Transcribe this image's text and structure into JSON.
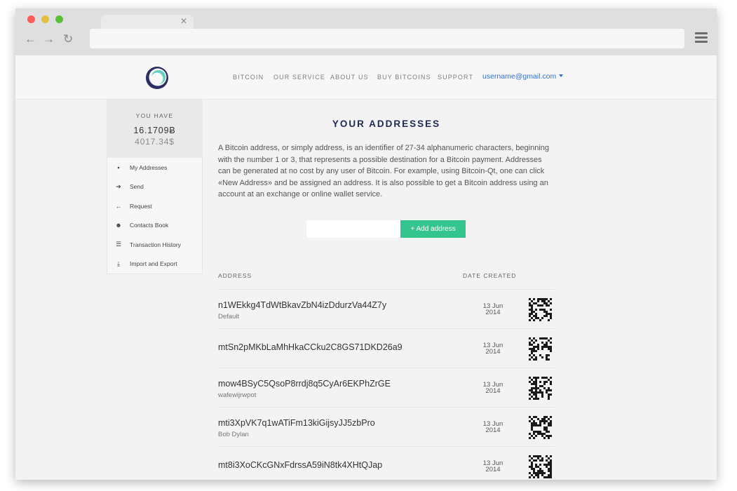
{
  "header": {
    "nav": [
      "BITCOIN",
      "OUR SERVICE",
      "ABOUT US",
      "BUY BITCOINS",
      "SUPPORT"
    ],
    "user": "username@gmail.com"
  },
  "sidebar": {
    "balance_label": "YOU HAVE",
    "balance_btc": "16.1709Ƀ",
    "balance_usd": "4017.34$",
    "items": [
      {
        "label": "My Addresses",
        "icon": "briefcase-icon"
      },
      {
        "label": "Send",
        "icon": "arrow-right-icon"
      },
      {
        "label": "Request",
        "icon": "arrow-left-icon"
      },
      {
        "label": "Contacts Book",
        "icon": "users-icon"
      },
      {
        "label": "Transaction History",
        "icon": "list-icon"
      },
      {
        "label": "Import and Export",
        "icon": "download-icon"
      }
    ]
  },
  "main": {
    "title": "YOUR ADDRESSES",
    "intro": "A Bitcoin address, or simply address, is an identifier of 27-34 alphanumeric characters, beginning with the number 1 or 3, that represents a possible destination for a Bitcoin payment. Addresses can be generated at no cost by any user of Bitcoin. For example, using Bitcoin-Qt, one can click «New Address» and be assigned an address. It is also possible to get a Bitcoin address using an account at an exchange or online wallet service.",
    "add_input_placeholder": "",
    "add_button": "+ Add address",
    "table": {
      "headers": {
        "address": "ADDRESS",
        "date_created": "DATE CREATED"
      },
      "rows": [
        {
          "address": "n1WEkkg4TdWtBkavZbN4izDdurzVa44Z7y",
          "label": "Default",
          "date_day": "13 Jun",
          "date_year": "2014"
        },
        {
          "address": "mtSn2pMKbLaMhHkaCCku2C8GS71DKD26a9",
          "label": "",
          "date_day": "13 Jun",
          "date_year": "2014"
        },
        {
          "address": "mow4BSyC5QsoP8rrdj8q5CyAr6EKPhZrGE",
          "label": "wafewijrwpot",
          "date_day": "13 Jun",
          "date_year": "2014"
        },
        {
          "address": "mti3XpVK7q1wATiFm13kiGijsyJJ5zbPro",
          "label": "Bob Dylan",
          "date_day": "13 Jun",
          "date_year": "2014"
        },
        {
          "address": "mt8i3XoCKcGNxFdrssA59iN8tk4XHtQJap",
          "label": "",
          "date_day": "13 Jun",
          "date_year": "2014"
        }
      ]
    }
  },
  "colors": {
    "accent": "#34c48e",
    "title": "#1e2a56",
    "link": "#2f6fd0"
  }
}
